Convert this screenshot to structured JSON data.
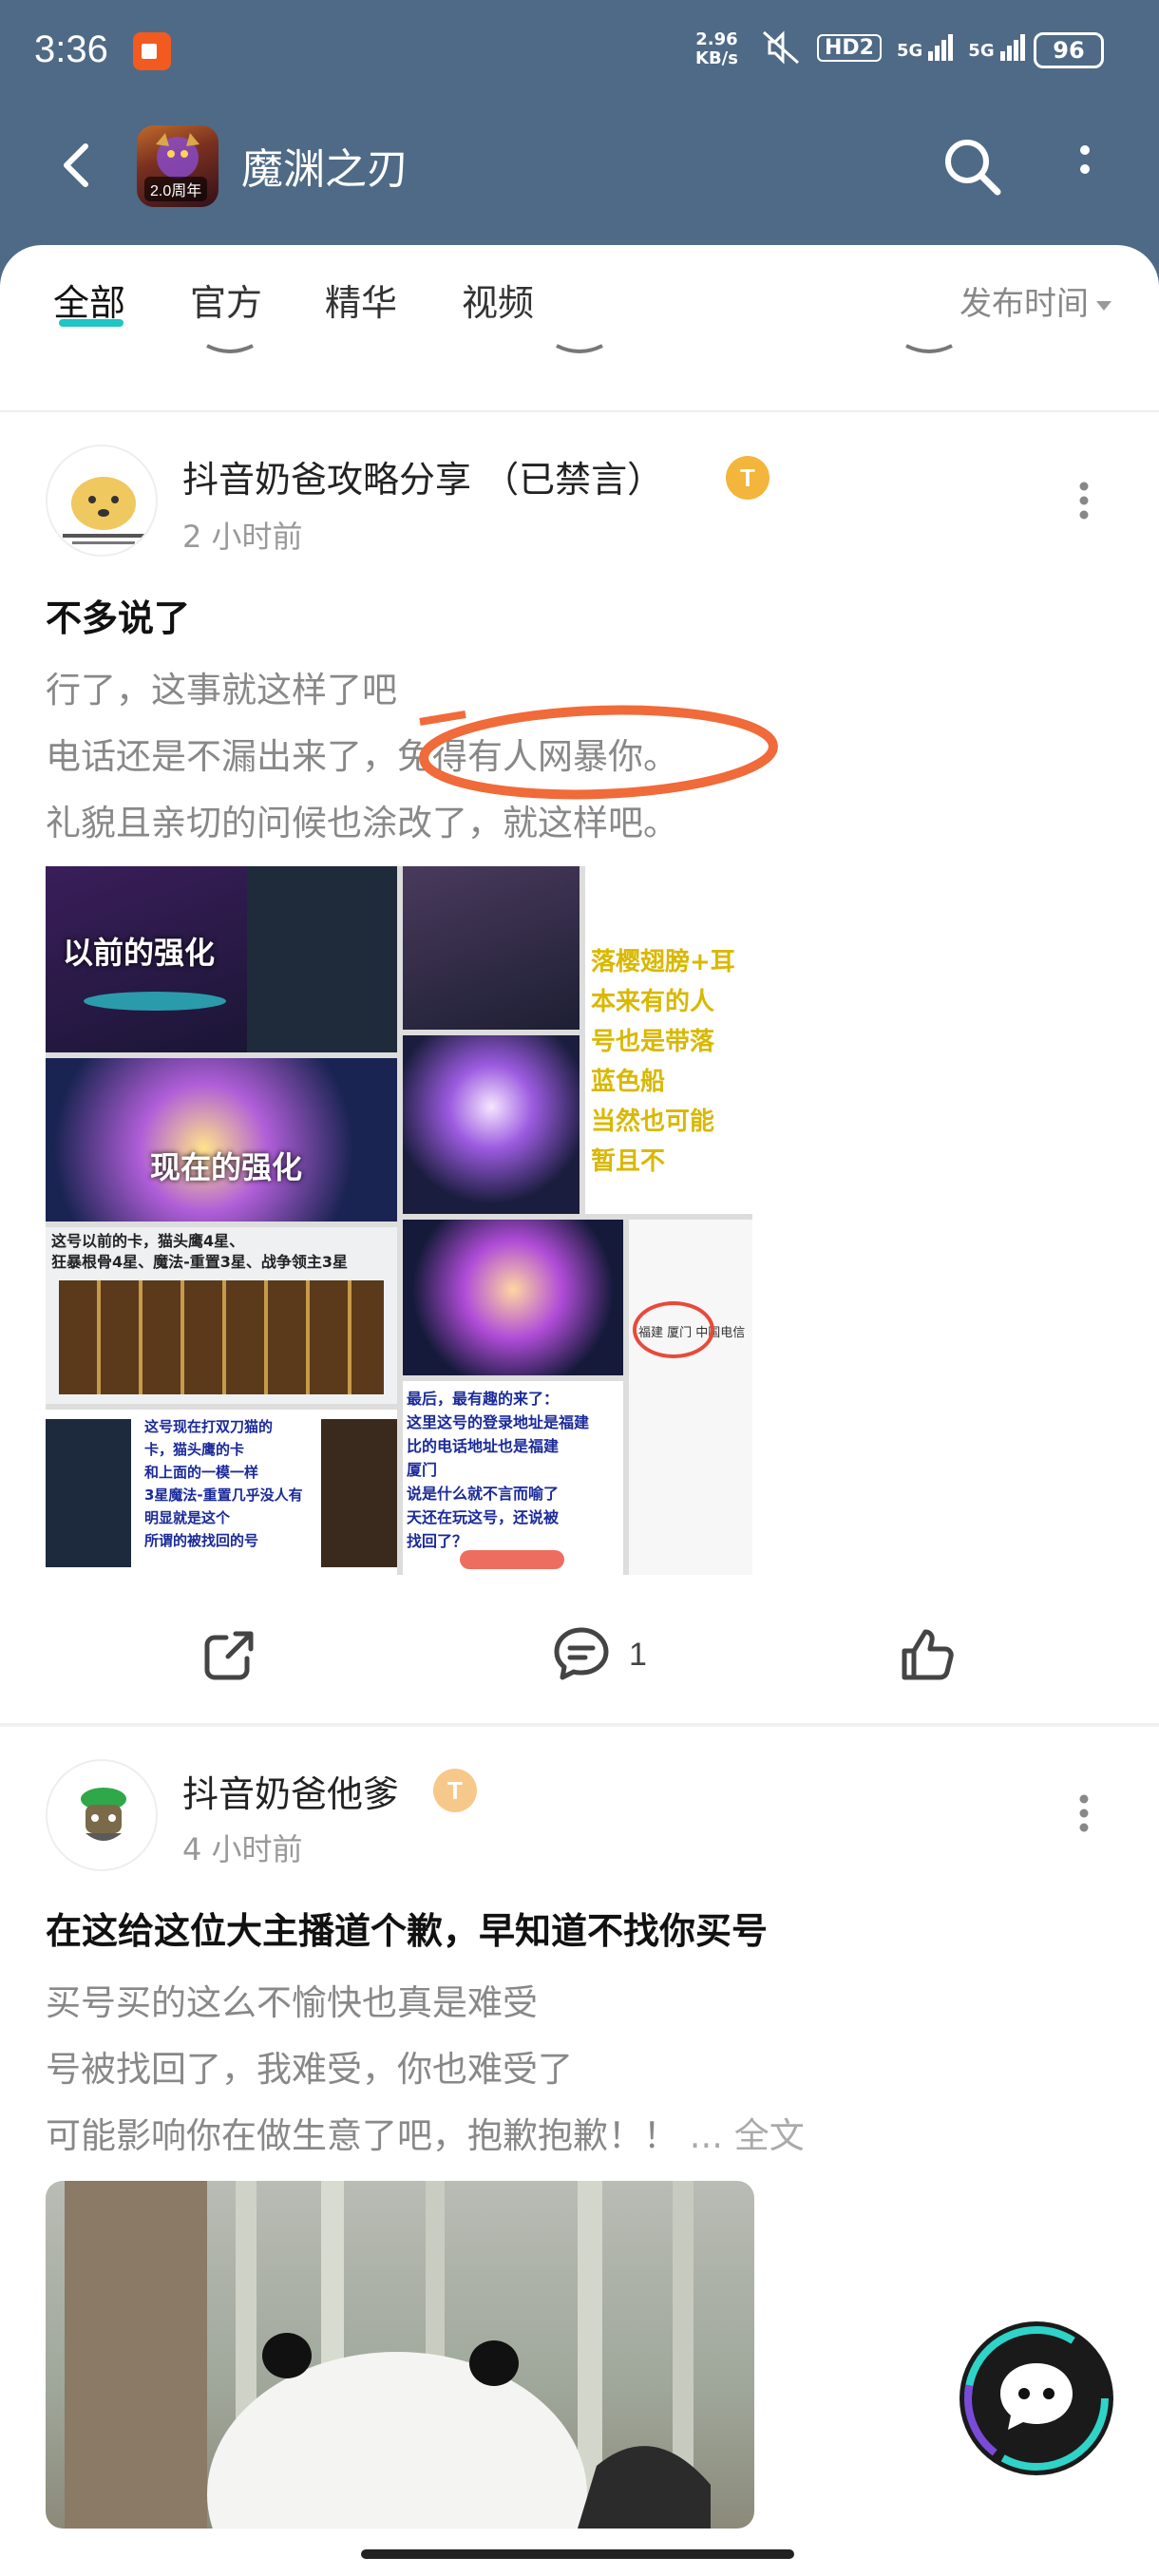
{
  "status_bar": {
    "time": "3:36",
    "net_speed_value": "2.96",
    "net_speed_unit": "KB/s",
    "hd_label": "HD2",
    "signal1": "5G",
    "signal2": "5G",
    "battery": "96"
  },
  "nav": {
    "title": "魔渊之刃",
    "logo_badge": "2.0周年"
  },
  "tabs": [
    {
      "label": "全部"
    },
    {
      "label": "官方"
    },
    {
      "label": "精华"
    },
    {
      "label": "视频"
    }
  ],
  "sort_label": "发布时间",
  "colors": {
    "header_bg": "#4e6a86",
    "accent": "#20c5c5",
    "level_badge_gold": "#f3b53c",
    "level_badge_light": "#f6c98b",
    "annotation_circle": "#f06a3a"
  },
  "posts": [
    {
      "author": "抖音奶爸攻略分享 （已禁言）",
      "level": "T",
      "time": "2 小时前",
      "title": "不多说了",
      "lines": [
        "行了，这事就这样了吧",
        "电话还是不漏出来了，免得有人网暴你。",
        "礼貌且亲切的问候也涂改了，就这样吧。"
      ],
      "images": {
        "img1_label": "以前的强化",
        "img3_label": "现在的强化",
        "img5_text": [
          "落樱翅膀+耳",
          "本来有的人",
          "号也是带落",
          "蓝色船",
          "当然也可能",
          "暂且不"
        ],
        "img6_text": [
          "这号以前的卡，猫头鹰4星、",
          "狂暴根骨4星、魔法-重置3星、战争领主3星"
        ],
        "img7_text": [
          "这号现在打双刀猫的",
          "卡，猫头鹰的卡",
          "和上面的一模一样",
          "3星魔法-重置几乎没人有",
          "明显就是这个",
          "所谓的被找回的号"
        ],
        "img8_text": [
          "最后，最有趣的来了：",
          "这里这号的登录地址是福建",
          "比的电话地址也是福建",
          "厦门",
          "说是什么就不言而喻了",
          "天还在玩这号，还说被",
          "找回了？"
        ],
        "img9_text": [
          "福建 厦门 中国电信"
        ]
      },
      "comment_count": "1"
    },
    {
      "author": "抖音奶爸他爹",
      "level": "T",
      "time": "4 小时前",
      "title": "在这给这位大主播道个歉，早知道不找你买号",
      "lines": [
        "买号买的这么不愉快也真是难受",
        "号被找回了，我难受，你也难受了",
        "可能影响你在做生意了吧，抱歉抱歉！！"
      ],
      "read_more": "... 全文"
    }
  ]
}
